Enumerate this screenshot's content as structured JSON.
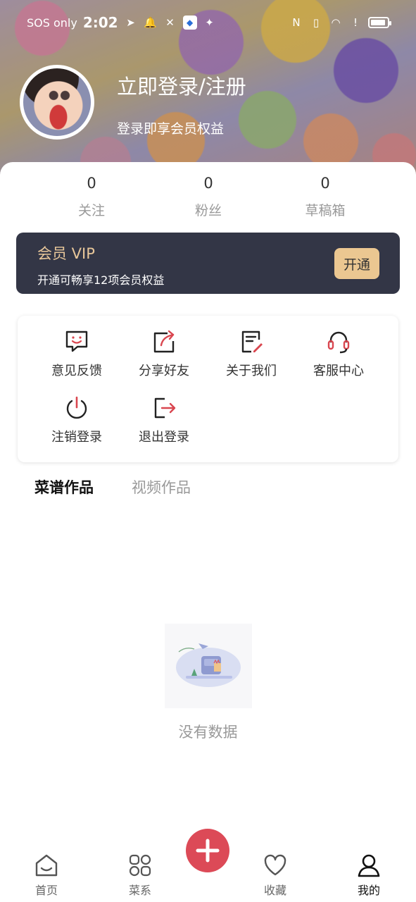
{
  "status_bar": {
    "carrier": "SOS only",
    "time": "2:02"
  },
  "profile": {
    "login_title": "立即登录/注册",
    "login_subtitle": "登录即享会员权益"
  },
  "stats": [
    {
      "value": "0",
      "label": "关注"
    },
    {
      "value": "0",
      "label": "粉丝"
    },
    {
      "value": "0",
      "label": "草稿箱"
    }
  ],
  "vip": {
    "title": "会员 VIP",
    "subtitle": "开通可畅享12项会员权益",
    "button": "开通"
  },
  "menu": [
    {
      "label": "意见反馈",
      "icon": "feedback-icon"
    },
    {
      "label": "分享好友",
      "icon": "share-icon"
    },
    {
      "label": "关于我们",
      "icon": "about-icon"
    },
    {
      "label": "客服中心",
      "icon": "headset-icon"
    },
    {
      "label": "注销登录",
      "icon": "power-icon"
    },
    {
      "label": "退出登录",
      "icon": "logout-icon"
    }
  ],
  "tabs": [
    {
      "label": "菜谱作品"
    },
    {
      "label": "视频作品"
    }
  ],
  "empty": {
    "text": "没有数据"
  },
  "bottom_nav": [
    {
      "label": "首页",
      "icon": "home-icon"
    },
    {
      "label": "菜系",
      "icon": "category-icon"
    },
    {
      "label": "收藏",
      "icon": "heart-icon"
    },
    {
      "label": "我的",
      "icon": "user-icon"
    }
  ],
  "colors": {
    "accent": "#dc4a57",
    "vip_bg": "#333646",
    "vip_gold": "#ebc791",
    "icon_red": "#d9464f"
  }
}
